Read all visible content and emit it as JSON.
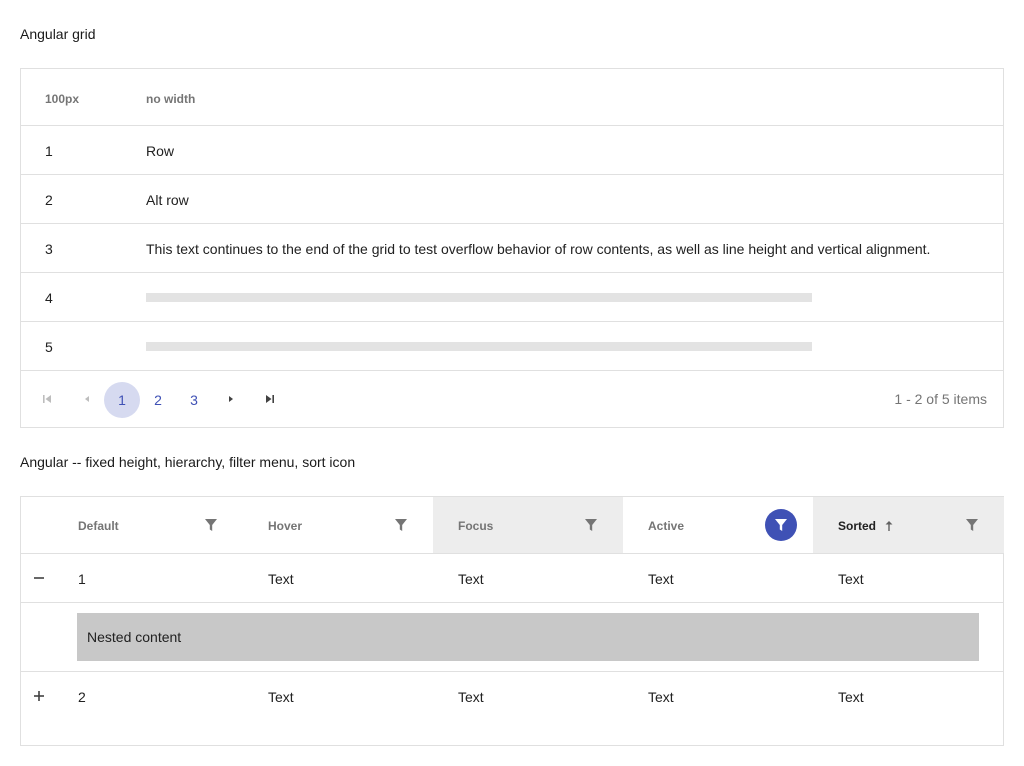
{
  "section1": {
    "title": "Angular grid"
  },
  "grid1": {
    "headers": [
      "100px",
      "no width"
    ],
    "rows": [
      {
        "id": "1",
        "text": "Row",
        "skeleton": false
      },
      {
        "id": "2",
        "text": "Alt row",
        "skeleton": false
      },
      {
        "id": "3",
        "text": "This text continues to the end of the grid to test overflow behavior of row contents, as well as line height and vertical alignment.",
        "skeleton": false
      },
      {
        "id": "4",
        "text": "",
        "skeleton": true
      },
      {
        "id": "5",
        "text": "",
        "skeleton": true
      }
    ],
    "pager": {
      "pages": [
        "1",
        "2",
        "3"
      ],
      "selected_page": "1",
      "info": "1 - 2 of 5 items",
      "icons": [
        "first-page-icon",
        "previous-page-icon",
        "next-page-icon",
        "last-page-icon"
      ]
    }
  },
  "section2": {
    "title": "Angular -- fixed height, hierarchy, filter menu, sort icon"
  },
  "grid2": {
    "headers": [
      {
        "label": "Default",
        "state": "default"
      },
      {
        "label": "Hover",
        "state": "hover"
      },
      {
        "label": "Focus",
        "state": "focus"
      },
      {
        "label": "Active",
        "state": "active"
      },
      {
        "label": "Sorted",
        "state": "sorted",
        "sort": "ascending"
      }
    ],
    "rows": [
      {
        "toggle": "collapse-icon",
        "cells": [
          "1",
          "Text",
          "Text",
          "Text",
          "Text"
        ]
      },
      {
        "toggle": "expand-icon",
        "cells": [
          "2",
          "Text",
          "Text",
          "Text",
          "Text"
        ]
      }
    ],
    "nested": {
      "text": "Nested content"
    }
  },
  "colors": {
    "accent": "#3f51b5",
    "selected_page_bg": "#d6daf0",
    "header_highlight": "#ededed",
    "nested_bg": "#c8c8c8",
    "skeleton": "#e3e3e3",
    "border": "#e0e0e0"
  }
}
